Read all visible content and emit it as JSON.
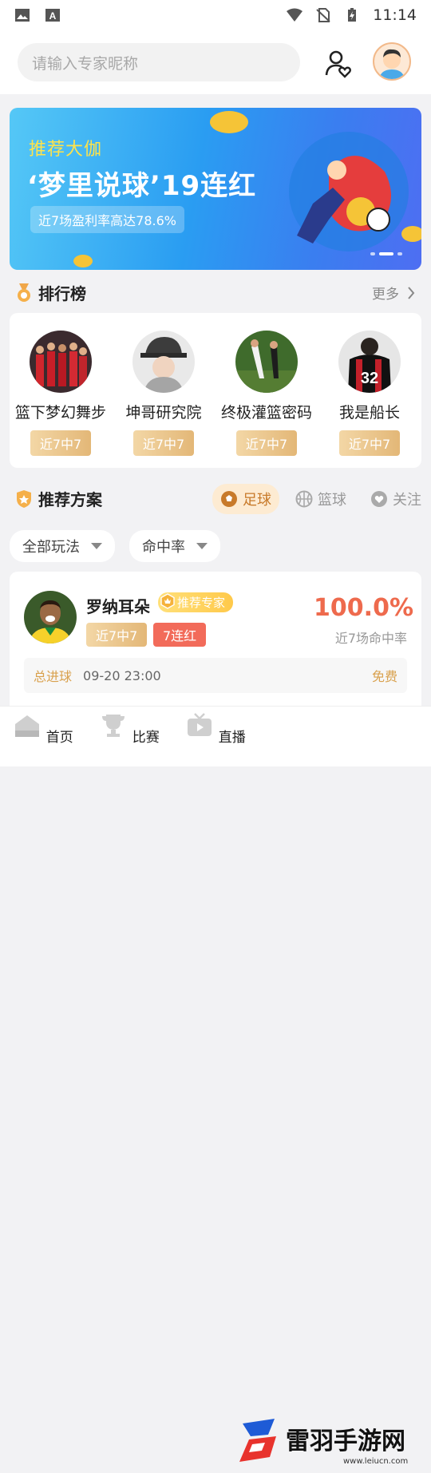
{
  "status_bar": {
    "time": "11:14"
  },
  "search": {
    "placeholder": "请输入专家昵称"
  },
  "banner": {
    "kicker": "推荐大伽",
    "title": "‘梦里说球’19连红",
    "pill": "近7场盈利率高达78.6%"
  },
  "ranking": {
    "title": "排行榜",
    "more": "更多",
    "items": [
      {
        "name": "篮下梦幻舞步",
        "badge": "近7中7"
      },
      {
        "name": "坤哥研究院",
        "badge": "近7中7"
      },
      {
        "name": "终极灌篮密码",
        "badge": "近7中7"
      },
      {
        "name": "我是船长",
        "badge": "近7中7"
      }
    ]
  },
  "recommend": {
    "title": "推荐方案",
    "tabs": [
      "足球",
      "篮球",
      "关注"
    ],
    "filters": [
      "全部玩法",
      "命中率"
    ]
  },
  "plan": {
    "name": "罗纳耳朵",
    "tag": "推荐专家",
    "badge1": "近7中7",
    "badge2": "7连红",
    "rate": "100.0%",
    "rate_label": "近7场命中率",
    "type": "总进球",
    "time": "09-20 23:00",
    "price": "免费"
  },
  "bottom_nav": [
    "首页",
    "比赛",
    "直播"
  ],
  "watermark": {
    "title": "雷羽手游网",
    "url": "www.leiucn.com"
  },
  "colors": {
    "accent": "#e3b777",
    "rate": "#ee6a4d",
    "banner": "#2a9df2"
  }
}
